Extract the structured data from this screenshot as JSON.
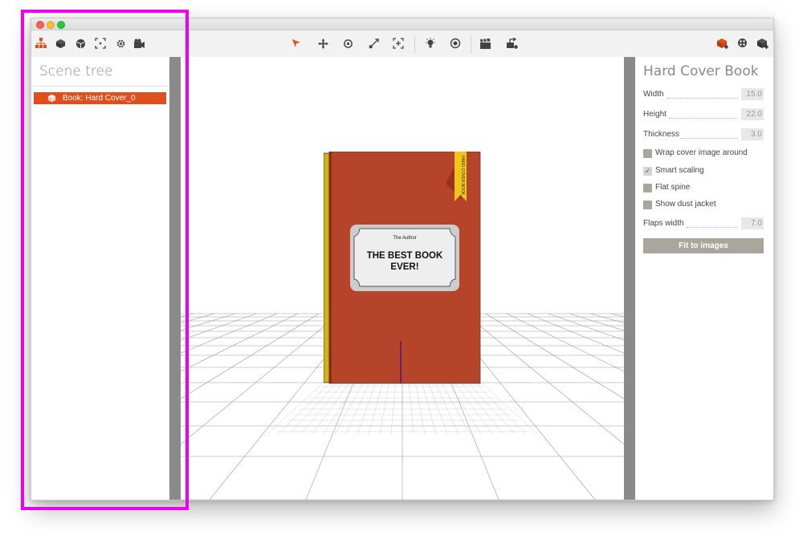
{
  "toolbar": {
    "left_icons": [
      "scene-tree-icon",
      "cube-icon",
      "sphere-icon",
      "frame-focus-icon",
      "gear-icon",
      "camera-icon"
    ],
    "center_icons": [
      "select-arrow-icon",
      "move-icon",
      "rotate-icon",
      "scale-icon",
      "fit-icon",
      "light-bulb-icon",
      "render-icon",
      "clapper-icon",
      "export-icon"
    ],
    "right_icons": [
      "red-cube-icon",
      "dice-icon",
      "add-cube-icon"
    ],
    "active_color": "#e04e1c"
  },
  "scene_tree": {
    "title": "Scene tree",
    "items": [
      {
        "label": "Book: Hard Cover_0",
        "icon": "cube-icon"
      }
    ]
  },
  "book": {
    "author": "The Author",
    "title_line1": "THE BEST BOOK",
    "title_line2": "EVER!",
    "ribbon_text": "HARD COVER BOOK",
    "cover_color": "#b6442a",
    "spine_color": "#e6c21a"
  },
  "properties": {
    "title": "Hard Cover Book",
    "fields": [
      {
        "label": "Width",
        "value": "15.0"
      },
      {
        "label": "Height",
        "value": "22.0"
      },
      {
        "label": "Thickness",
        "value": "3.0"
      }
    ],
    "checkboxes": [
      {
        "label": "Wrap cover image around",
        "checked": false
      },
      {
        "label": "Smart scaling",
        "checked": true
      },
      {
        "label": "Flat spine",
        "checked": false
      },
      {
        "label": "Show dust jacket",
        "checked": false
      }
    ],
    "flaps_width": {
      "label": "Flaps width",
      "value": "7.0"
    },
    "fit_button": "Fit to images"
  }
}
